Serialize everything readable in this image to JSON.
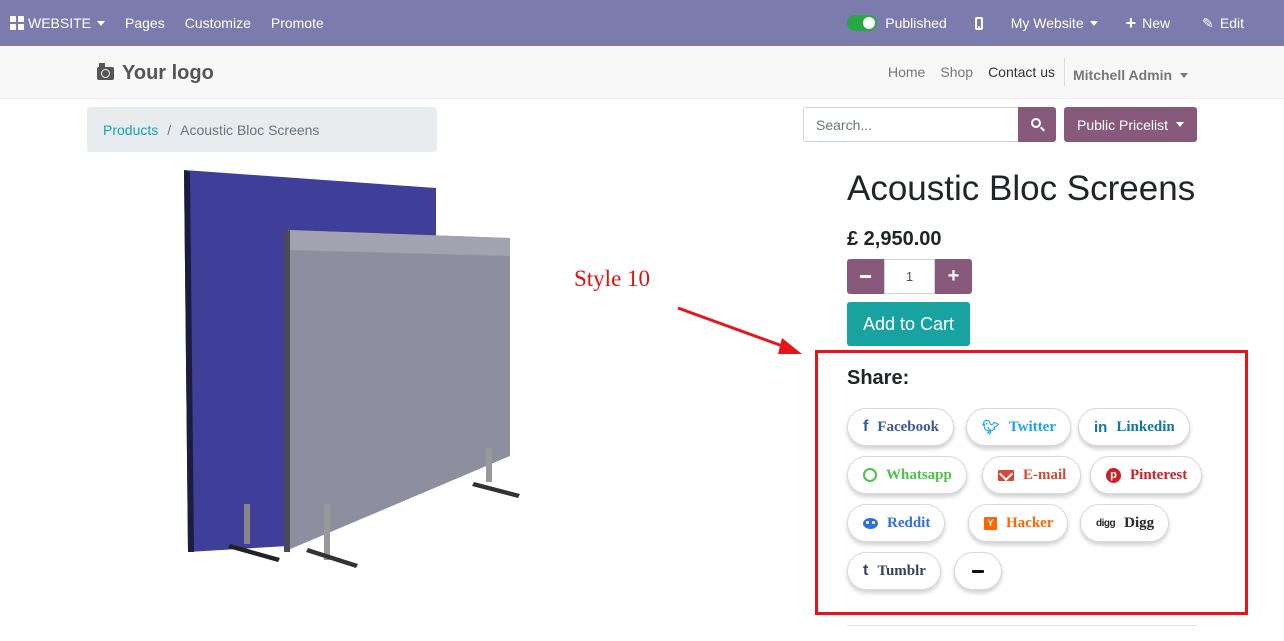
{
  "admin_bar": {
    "website_label": "WEBSITE",
    "pages_label": "Pages",
    "customize_label": "Customize",
    "promote_label": "Promote",
    "published_label": "Published",
    "my_website_label": "My Website",
    "new_label": "New",
    "edit_label": "Edit",
    "bar_color": "#7c7bad"
  },
  "header": {
    "logo_text": "Your logo",
    "nav": [
      "Home",
      "Shop",
      "Contact us"
    ],
    "user": "Mitchell Admin"
  },
  "breadcrumb": {
    "parent": "Products",
    "separator": "/",
    "current": "Acoustic Bloc Screens"
  },
  "search": {
    "placeholder": "Search...",
    "pricelist_label": "Public Pricelist"
  },
  "product": {
    "name": "Acoustic Bloc Screens",
    "price": "£ 2,950.00",
    "quantity": "1",
    "add_to_cart_label": "Add to Cart"
  },
  "annotation": {
    "label": "Style 10",
    "color": "#e8141a"
  },
  "share": {
    "title": "Share:",
    "buttons": [
      {
        "label": "Facebook",
        "icon": "facebook-icon",
        "color": "#3b5998"
      },
      {
        "label": "Twitter",
        "icon": "twitter-icon",
        "color": "#1da1f2"
      },
      {
        "label": "Linkedin",
        "icon": "linkedin-icon",
        "color": "#0e76a8"
      },
      {
        "label": "Whatsapp",
        "icon": "whatsapp-icon",
        "color": "#4dc247"
      },
      {
        "label": "E-mail",
        "icon": "email-icon",
        "color": "#d34836"
      },
      {
        "label": "Pinterest",
        "icon": "pinterest-icon",
        "color": "#cb2027"
      },
      {
        "label": "Reddit",
        "icon": "reddit-icon",
        "color": "#2d72d9"
      },
      {
        "label": "Hacker",
        "icon": "hacker-news-icon",
        "color": "#ff6600"
      },
      {
        "label": "Digg",
        "icon": "digg-icon",
        "color": "#262626"
      },
      {
        "label": "Tumblr",
        "icon": "tumblr-icon",
        "color": "#34465d"
      }
    ]
  },
  "colors": {
    "primary": "#875a7b",
    "cart": "#18a2a0",
    "link": "#17a2b8"
  }
}
